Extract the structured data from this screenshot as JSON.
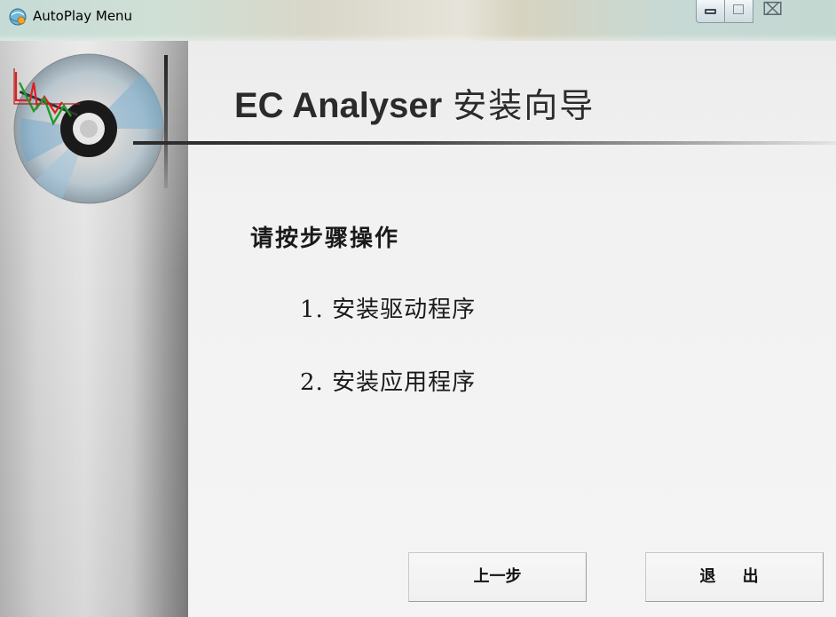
{
  "window": {
    "title": "AutoPlay Menu",
    "icons": {
      "app": "autoplay-globe-icon",
      "minimize": "minimize-icon",
      "maximize": "maximize-icon",
      "close": "close-icon"
    },
    "close_glyph": "⌧"
  },
  "header": {
    "title_en": "EC Analyser",
    "title_cn": "安装向导",
    "logo": "cd-disc-with-chart-icon"
  },
  "content": {
    "instruction": "请按步骤操作",
    "steps": [
      {
        "label": "1. 安装驱动程序"
      },
      {
        "label": "2. 安装应用程序"
      }
    ]
  },
  "buttons": {
    "prev_label": "上一步",
    "exit_label": "退 出"
  },
  "colors": {
    "titlebar": "#c9dcd6",
    "sidebar": "#cfcfcf",
    "content_bg": "#f2f2f2",
    "text": "#1a1a1a",
    "chart_red": "#e02020",
    "chart_green": "#1f9a2a"
  }
}
